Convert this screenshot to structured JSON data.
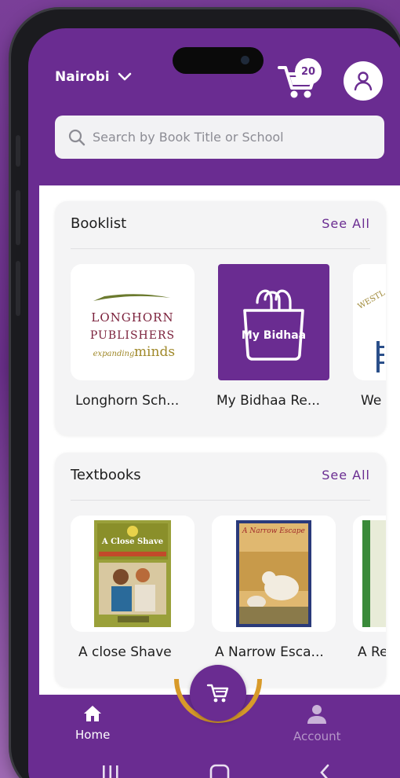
{
  "header": {
    "location": "Nairobi",
    "cart_count": "20"
  },
  "search": {
    "placeholder": "Search by Book Title or School"
  },
  "sections": [
    {
      "title": "Booklist",
      "see_all": "See All",
      "items": [
        {
          "label": "Longhorn Sch...",
          "logo_line1": "LONGHORN",
          "logo_line2": "PUBLISHERS",
          "logo_line3a": "expanding",
          "logo_line3b": "minds"
        },
        {
          "label": "My Bidhaa Re...",
          "logo_text": "My Bidhaa"
        },
        {
          "label": "We",
          "logo_text": "WESTL"
        }
      ]
    },
    {
      "title": "Textbooks",
      "see_all": "See All",
      "items": [
        {
          "label": "A close Shave",
          "cover_title": "A Close Shave"
        },
        {
          "label": "A Narrow Esca...",
          "cover_title": "A Narrow Escape"
        },
        {
          "label": "A Re"
        }
      ]
    }
  ],
  "nav": {
    "home": "Home",
    "account": "Account"
  },
  "colors": {
    "brand_purple": "#6a2c91",
    "accent_gold": "#d89a2a"
  }
}
